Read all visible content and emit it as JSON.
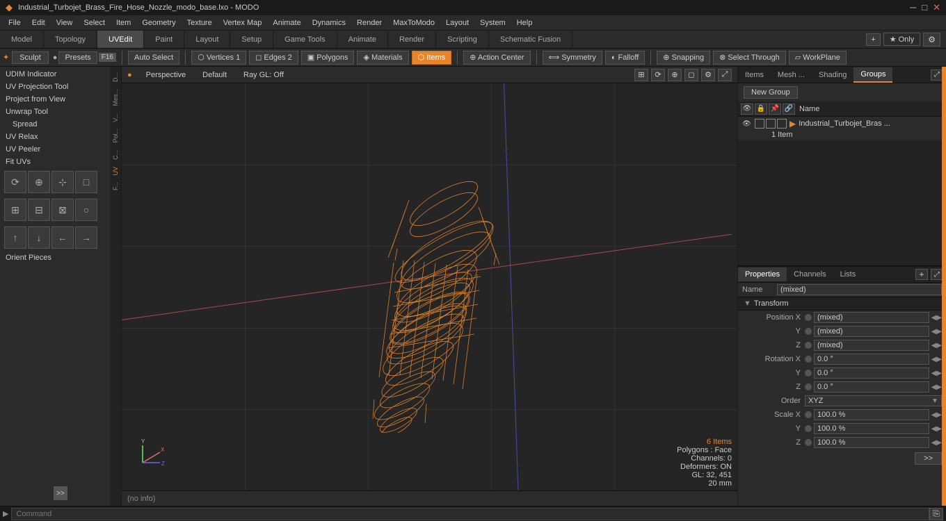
{
  "titlebar": {
    "title": "Industrial_Turbojet_Brass_Fire_Hose_Nozzle_modo_base.lxo - MODO",
    "minimize": "─",
    "maximize": "□",
    "close": "✕"
  },
  "menubar": {
    "items": [
      "File",
      "Edit",
      "View",
      "Select",
      "Item",
      "Geometry",
      "Texture",
      "Vertex Map",
      "Animate",
      "Dynamics",
      "Render",
      "MaxToModo",
      "Layout",
      "System",
      "Help"
    ]
  },
  "tabbar": {
    "tabs": [
      "Model",
      "Topology",
      "UVEdit",
      "Paint",
      "Layout",
      "Setup",
      "Game Tools",
      "Animate",
      "Render",
      "Scripting",
      "Schematic Fusion"
    ],
    "plus": "+",
    "star_only": "★  Only",
    "gear": "⚙"
  },
  "toolbar": {
    "sculpt": "Sculpt",
    "presets": "Presets",
    "f16": "F16",
    "auto_select": "Auto Select",
    "vertices": "Vertices",
    "vertices_count": "1",
    "edges": "Edges",
    "edges_count": "2",
    "polygons": "Polygons",
    "materials": "Materials",
    "items": "Items",
    "action_center": "Action Center",
    "symmetry": "Symmetry",
    "falloff": "Falloff",
    "snapping": "Snapping",
    "select_through": "Select Through",
    "workplane": "WorkPlane"
  },
  "left_panel": {
    "tools": [
      "UDIM Indicator",
      "UV Projection Tool",
      "Project from View",
      "Unwrap Tool",
      "Spread",
      "UV Relax",
      "UV Peeler",
      "Fit UVs",
      "Orient Pieces"
    ],
    "side_tabs": [
      "D...",
      "Mes...",
      "V...",
      "Pol...",
      "C...",
      "UV",
      "F..."
    ]
  },
  "viewport": {
    "perspective_tab": "Perspective",
    "default_tab": "Default",
    "raygl": "Ray GL: Off",
    "info": {
      "items": "6 Items",
      "polygons": "Polygons : Face",
      "channels": "Channels: 0",
      "deformers": "Deformers: ON",
      "gl": "GL: 32, 451",
      "size": "20 mm"
    },
    "status": "(no info)"
  },
  "right_panel": {
    "tabs": [
      "Items",
      "Mesh ...",
      "Shading",
      "Groups"
    ],
    "new_group_btn": "New Group",
    "groups_header_name": "Name",
    "group_item_name": "Industrial_Turbojet_Bras ...",
    "group_item_sub": "1 Item",
    "properties": {
      "tabs": [
        "Properties",
        "Channels",
        "Lists"
      ],
      "plus": "+",
      "name_label": "Name",
      "name_value": "(mixed)",
      "transform_label": "Transform",
      "position_x_label": "Position X",
      "position_x_value": "(mixed)",
      "position_y_label": "Y",
      "position_y_value": "(mixed)",
      "position_z_label": "Z",
      "position_z_value": "(mixed)",
      "rotation_x_label": "Rotation X",
      "rotation_x_value": "0.0 °",
      "rotation_y_label": "Y",
      "rotation_y_value": "0.0 °",
      "rotation_z_label": "Z",
      "rotation_z_value": "0.0 °",
      "order_label": "Order",
      "order_value": "XYZ",
      "scale_x_label": "Scale X",
      "scale_x_value": "100.0 %",
      "scale_y_label": "Y",
      "scale_y_value": "100.0 %",
      "scale_z_label": "Z",
      "scale_z_value": "100.0 %"
    }
  },
  "commandbar": {
    "placeholder": "Command",
    "arrow": "▶"
  },
  "colors": {
    "accent": "#e6852a",
    "active_tab_bg": "#4a4a4a",
    "panel_bg": "#2b2b2b",
    "dark_bg": "#1e1e1e"
  }
}
